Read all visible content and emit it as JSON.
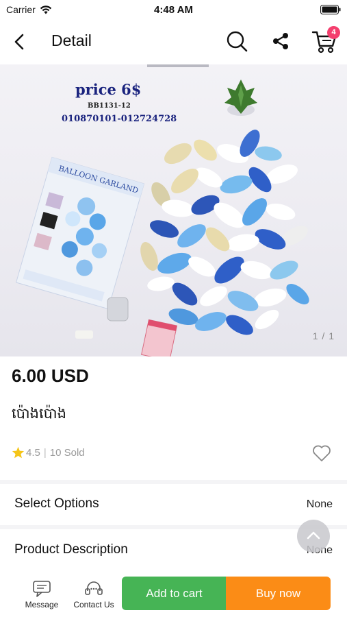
{
  "status_bar": {
    "carrier": "Carrier",
    "time": "4:48 AM"
  },
  "header": {
    "title": "Detail",
    "cart_count": "4"
  },
  "hero": {
    "price_tag": "price 6$",
    "code": "BB1131-12",
    "phones": "010870101-012724728",
    "pager": "1 / 1"
  },
  "product": {
    "price": "6.00 USD",
    "name": "ប៉ោងប៉ោង",
    "rating": "4.5",
    "separator": "|",
    "sold": "10 Sold"
  },
  "options": {
    "label": "Select Options",
    "value": "None"
  },
  "description": {
    "label": "Product Description",
    "value": "None"
  },
  "bottom_bar": {
    "message": "Message",
    "contact": "Contact Us",
    "add_to_cart": "Add to cart",
    "buy_now": "Buy now"
  },
  "colors": {
    "green": "#46b455",
    "orange": "#fb8c16",
    "badge": "#f43f6e",
    "star": "#f5c518"
  }
}
